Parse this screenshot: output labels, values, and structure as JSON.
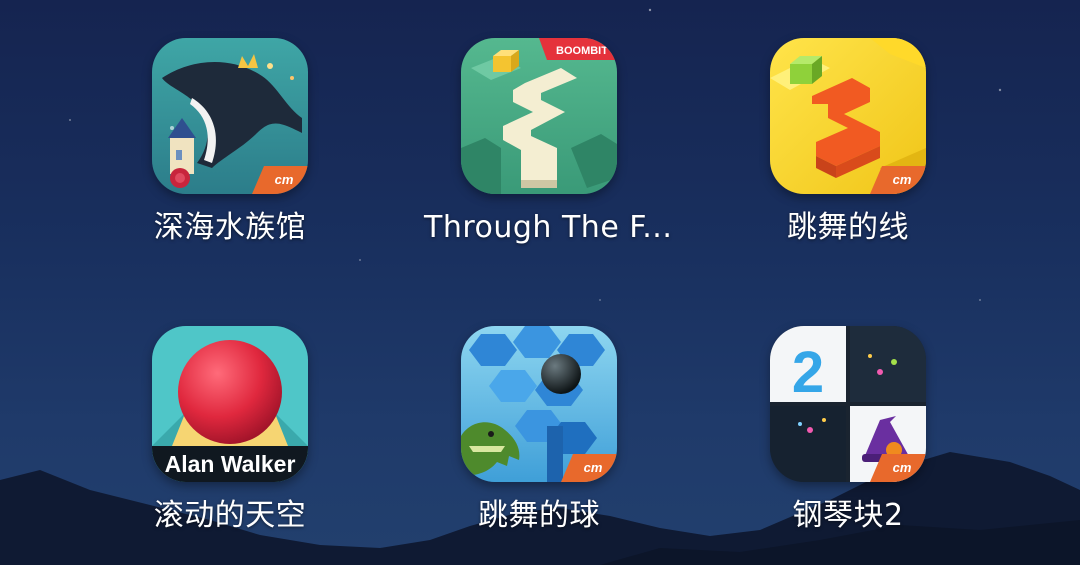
{
  "wallpaper": {
    "sky_top": "#152450",
    "sky_bottom": "#22406e",
    "mountain_color": "#0f1a33"
  },
  "apps": [
    {
      "label": "深海水族馆",
      "icon_name": "deep-sea-aquarium-icon",
      "badge": "cm"
    },
    {
      "label": "Through The F...",
      "icon_name": "through-the-forest-icon",
      "badge": "BOOMBIT"
    },
    {
      "label": "跳舞的线",
      "icon_name": "dancing-line-icon",
      "badge": "cm"
    },
    {
      "label": "滚动的天空",
      "icon_name": "rolling-sky-icon",
      "badge": "Alan Walker"
    },
    {
      "label": "跳舞的球",
      "icon_name": "dancing-ball-icon",
      "badge": "cm"
    },
    {
      "label": "钢琴块2",
      "icon_name": "piano-tiles-2-icon",
      "badge": "2"
    }
  ]
}
